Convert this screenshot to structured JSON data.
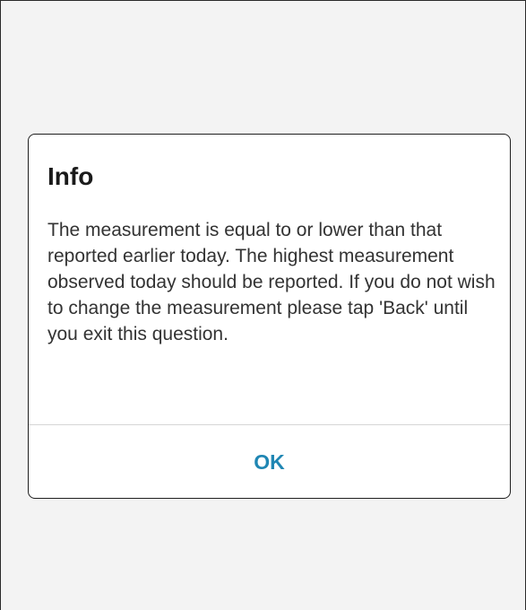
{
  "dialog": {
    "title": "Info",
    "message": "The measurement is equal to or lower than that reported earlier today. The highest measurement observed today should be reported. If you do not wish to change the measurement please tap 'Back' until you exit this question.",
    "ok_label": "OK"
  },
  "colors": {
    "background": "#f3f3f3",
    "dialog_background": "#ffffff",
    "button_text": "#1f86b3",
    "title_text": "#1a1a1a",
    "body_text": "#333333"
  }
}
